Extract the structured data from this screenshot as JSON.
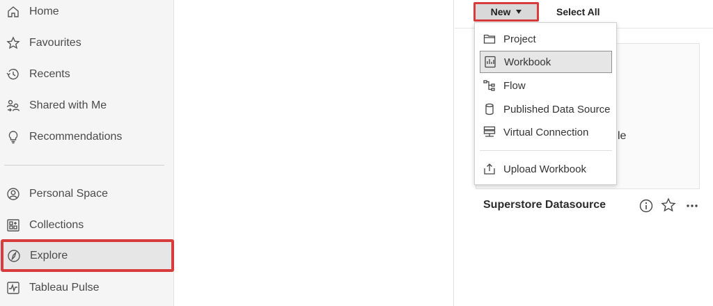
{
  "sidebar": {
    "items": [
      {
        "label": "Home",
        "icon": "home-icon"
      },
      {
        "label": "Favourites",
        "icon": "star-icon"
      },
      {
        "label": "Recents",
        "icon": "history-icon"
      },
      {
        "label": "Shared with Me",
        "icon": "shared-users-icon"
      },
      {
        "label": "Recommendations",
        "icon": "lightbulb-icon"
      },
      {
        "label": "Personal Space",
        "icon": "person-icon"
      },
      {
        "label": "Collections",
        "icon": "collections-grid-icon"
      },
      {
        "label": "Explore",
        "icon": "compass-icon",
        "selected": true
      },
      {
        "label": "Tableau Pulse",
        "icon": "pulse-icon"
      }
    ]
  },
  "toolbar": {
    "new_label": "New",
    "select_all_label": "Select All"
  },
  "menu": {
    "items": [
      {
        "label": "Project",
        "icon": "folder-icon"
      },
      {
        "label": "Workbook",
        "icon": "workbook-icon",
        "highlighted": true
      },
      {
        "label": "Flow",
        "icon": "flow-icon"
      },
      {
        "label": "Published Data Source",
        "icon": "database-icon"
      },
      {
        "label": "Virtual Connection",
        "icon": "server-icon"
      },
      {
        "label": "Upload Workbook",
        "icon": "upload-icon"
      }
    ]
  },
  "content": {
    "card_peek_text": "le",
    "datasource_title": "Superstore Datasource"
  },
  "colors": {
    "highlight_border": "#d73b3b",
    "sidebar_bg": "#f5f5f5",
    "selected_bg": "#e6e6e6"
  }
}
